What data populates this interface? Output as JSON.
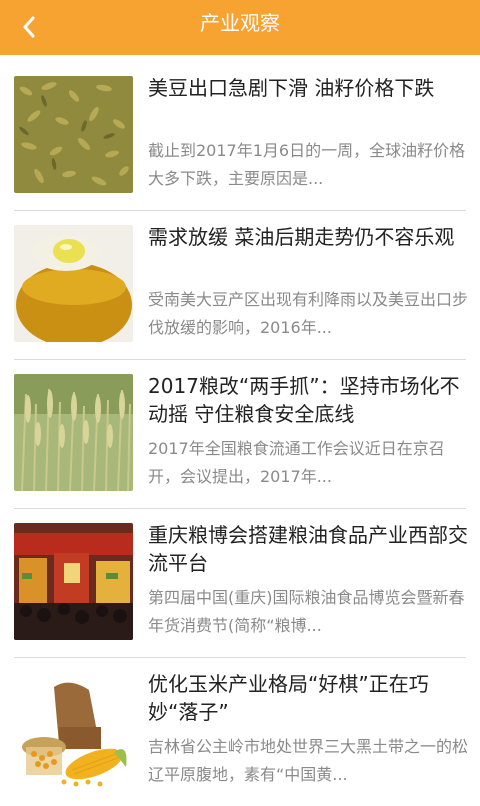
{
  "header": {
    "title": "产业观察"
  },
  "articles": [
    {
      "title": "美豆出口急剧下滑 油籽价格下跌",
      "summary": "截止到2017年1月6日的一周，全球油籽价格大多下跌，主要原因是..."
    },
    {
      "title": "需求放缓 菜油后期走势仍不容乐观",
      "summary": "受南美大豆产区出现有利降雨以及美豆出口步伐放缓的影响，2016年..."
    },
    {
      "title": "2017粮改“两手抓”：坚持市场化不动摇 守住粮食安全底线",
      "summary": "2017年全国粮食流通工作会议近日在京召开，会议提出，2017年..."
    },
    {
      "title": "重庆粮博会搭建粮油食品产业西部交流平台",
      "summary": "第四届中国(重庆)国际粮油食品博览会暨新春年货消费节(简称“粮博..."
    },
    {
      "title": "优化玉米产业格局“好棋”正在巧妙“落子”",
      "summary": "吉林省公主岭市地处世界三大黑土带之一的松辽平原腹地，素有“中国黄..."
    }
  ]
}
